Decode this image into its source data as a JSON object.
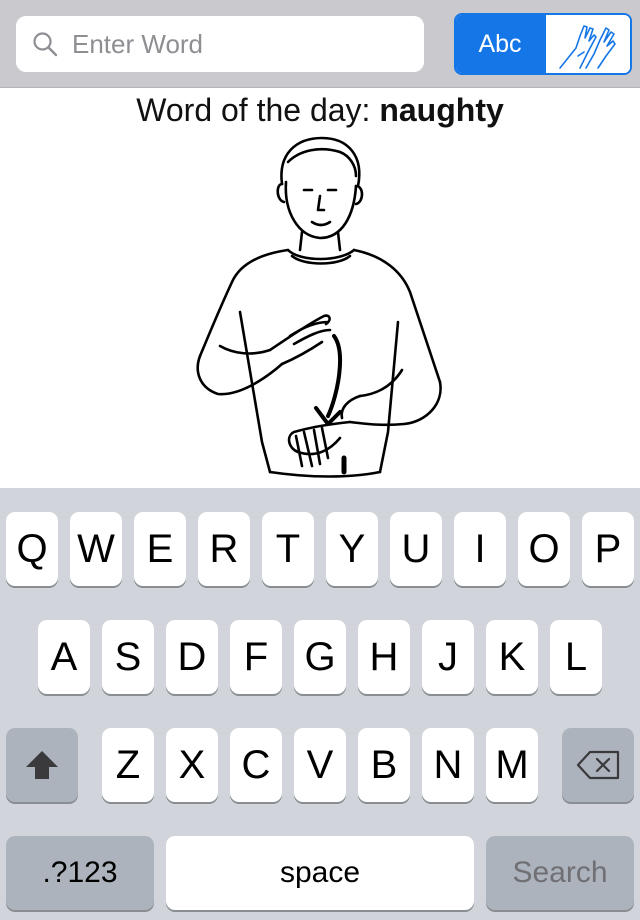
{
  "search": {
    "placeholder": "Enter Word",
    "value": ""
  },
  "mode_toggle": {
    "text_option": "Abc",
    "sign_option_icon": "signing-hands-icon",
    "selected": "Abc"
  },
  "word_of_day": {
    "prefix": "Word of the day: ",
    "word": "naughty"
  },
  "keyboard": {
    "row1": [
      "Q",
      "W",
      "E",
      "R",
      "T",
      "Y",
      "U",
      "I",
      "O",
      "P"
    ],
    "row2": [
      "A",
      "S",
      "D",
      "F",
      "G",
      "H",
      "J",
      "K",
      "L"
    ],
    "row3": [
      "Z",
      "X",
      "C",
      "V",
      "B",
      "N",
      "M"
    ],
    "numbers_label": ".?123",
    "space_label": "space",
    "search_label": "Search",
    "shift_icon": "shift-icon",
    "delete_icon": "delete-icon"
  },
  "colors": {
    "accent": "#1576e8",
    "topbar": "#c9c9ce",
    "keyboard_bg": "#d1d5db",
    "dark_key": "#adb3bc"
  }
}
